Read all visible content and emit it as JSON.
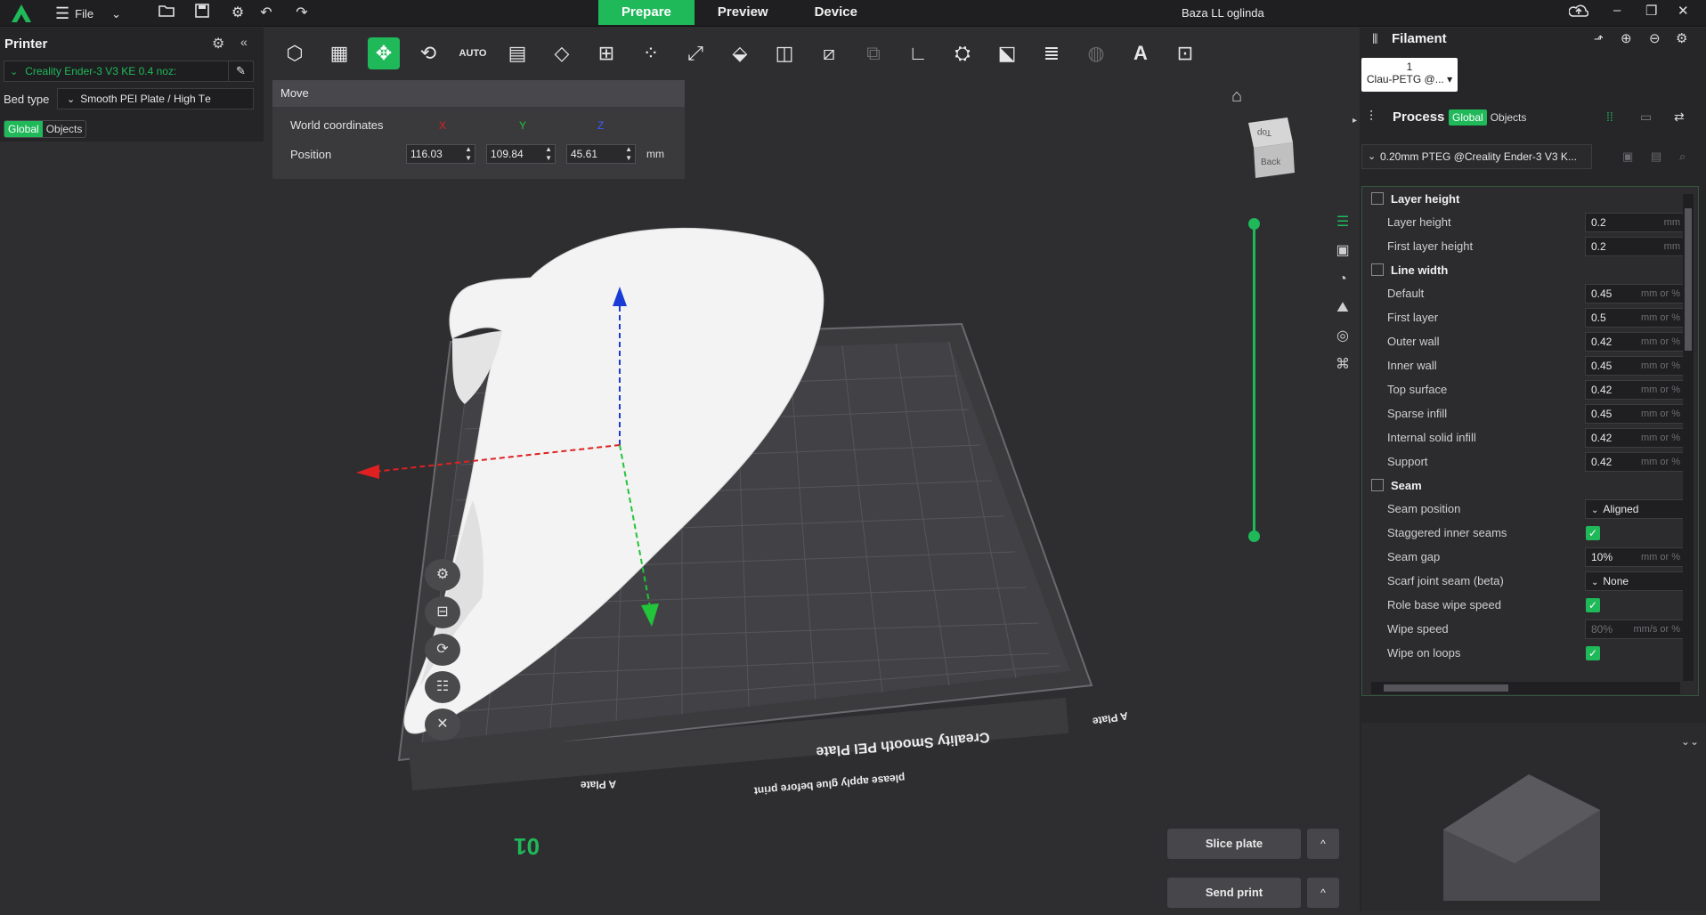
{
  "topbar": {
    "file_label": "File",
    "tabs": [
      "Prepare",
      "Preview",
      "Device"
    ],
    "window_title": "Baza LL oglinda"
  },
  "printer_panel": {
    "title": "Printer",
    "printer_name": "Creality Ender-3 V3 KE 0.4 noz:",
    "bed_type_label": "Bed type",
    "bed_type_value": "Smooth PEI Plate / High Tе",
    "seg_global": "Global",
    "seg_objects": "Objects"
  },
  "move_panel": {
    "title": "Move",
    "world_label": "World coordinates",
    "axes": [
      "X",
      "Y",
      "Z"
    ],
    "position_label": "Position",
    "x": "116.03",
    "y": "109.84",
    "z": "45.61",
    "unit": "mm"
  },
  "viewport": {
    "cube_top": "Top",
    "cube_back": "Back",
    "plate_brand": "Creality Smooth PEI Plate",
    "plate_note": "please apply glue before print",
    "plate_side_label": "A Plate",
    "plate_number": "01"
  },
  "actions": {
    "slice_label": "Slice plate",
    "send_label": "Send print",
    "caret": "^"
  },
  "filament": {
    "title": "Filament",
    "slot_number": "1",
    "slot_name": "Clau-PETG @..."
  },
  "process": {
    "title": "Process",
    "seg_global": "Global",
    "seg_objects": "Objects",
    "preset": "0.20mm PTEG @Creality Ender-3 V3 K..."
  },
  "settings": {
    "sections": [
      {
        "title": "Layer height",
        "options": [
          {
            "label": "Layer height",
            "value": "0.2",
            "unit": "mm"
          },
          {
            "label": "First layer height",
            "value": "0.2",
            "unit": "mm"
          }
        ]
      },
      {
        "title": "Line width",
        "options": [
          {
            "label": "Default",
            "value": "0.45",
            "unit": "mm or %"
          },
          {
            "label": "First layer",
            "value": "0.5",
            "unit": "mm or %"
          },
          {
            "label": "Outer wall",
            "value": "0.42",
            "unit": "mm or %"
          },
          {
            "label": "Inner wall",
            "value": "0.45",
            "unit": "mm or %"
          },
          {
            "label": "Top surface",
            "value": "0.42",
            "unit": "mm or %"
          },
          {
            "label": "Sparse infill",
            "value": "0.45",
            "unit": "mm or %"
          },
          {
            "label": "Internal solid infill",
            "value": "0.42",
            "unit": "mm or %"
          },
          {
            "label": "Support",
            "value": "0.42",
            "unit": "mm or %"
          }
        ]
      },
      {
        "title": "Seam",
        "options": [
          {
            "label": "Seam position",
            "value": "Aligned",
            "kind": "select"
          },
          {
            "label": "Staggered inner seams",
            "checked": true,
            "kind": "check"
          },
          {
            "label": "Seam gap",
            "value": "10%",
            "unit": "mm or %"
          },
          {
            "label": "Scarf joint seam (beta)",
            "value": "None",
            "kind": "select"
          },
          {
            "label": "Role base wipe speed",
            "checked": true,
            "kind": "check"
          },
          {
            "label": "Wipe speed",
            "value": "80%",
            "unit": "mm/s or %",
            "muted": true
          },
          {
            "label": "Wipe on loops",
            "checked": true,
            "kind": "check"
          }
        ]
      }
    ]
  },
  "colors": {
    "accent": "#1fb95a",
    "axis_x": "#e02020",
    "axis_y": "#22c43a",
    "axis_z": "#1a3cd6"
  }
}
